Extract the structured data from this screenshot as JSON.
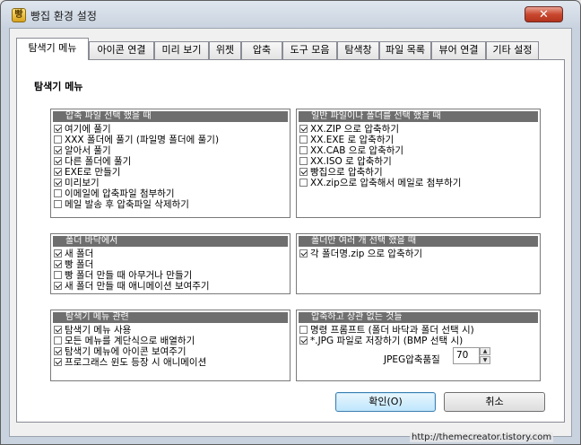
{
  "window": {
    "title": "빵집 환경 설정",
    "app_icon": "bread-app-icon",
    "close_label": "✕"
  },
  "tabs": [
    {
      "label": "탐색기 메뉴",
      "active": true
    },
    {
      "label": "아이콘 연결",
      "active": false
    },
    {
      "label": "미리 보기",
      "active": false
    },
    {
      "label": "위젯",
      "active": false
    },
    {
      "label": "압축",
      "active": false
    },
    {
      "label": "도구 모음",
      "active": false
    },
    {
      "label": "탐색창",
      "active": false
    },
    {
      "label": "파일 목록",
      "active": false
    },
    {
      "label": "뷰어 연결",
      "active": false
    },
    {
      "label": "기타 설정",
      "active": false
    }
  ],
  "panel": {
    "title": "탐색기 메뉴",
    "groups": [
      {
        "header": "압축 파일 선택 했을 때",
        "options": [
          {
            "label": "여기에 풀기",
            "checked": true
          },
          {
            "label": "XXX 폴더에 풀기 (파일명 폴더에 풀기)",
            "checked": true
          },
          {
            "label": "알아서 풀기",
            "checked": true
          },
          {
            "label": "다른 폴더에 풀기",
            "checked": true
          },
          {
            "label": "EXE로 만들기",
            "checked": true
          },
          {
            "label": "미리보기",
            "checked": true
          },
          {
            "label": "이메일에 압축파일 첨부하기",
            "checked": false
          },
          {
            "label": "메일 발송 후 압축파일 삭제하기",
            "checked": false
          }
        ]
      },
      {
        "header": "일반 파일이나 폴더를 선택 했을 때",
        "options": [
          {
            "label": "XX.ZIP 으로 압축하기",
            "checked": true
          },
          {
            "label": "XX.EXE 로 압축하기",
            "checked": false
          },
          {
            "label": "XX.CAB 으로 압축하기",
            "checked": false
          },
          {
            "label": "XX.ISO 로 압축하기",
            "checked": false
          },
          {
            "label": "빵집으로 압축하기",
            "checked": true
          },
          {
            "label": "XX.zip으로 압축해서 메일로 첨부하기",
            "checked": false
          }
        ]
      },
      {
        "header": "폴더 바닥에서",
        "options": [
          {
            "label": "새 폴더",
            "checked": true
          },
          {
            "label": "빵 폴더",
            "checked": true
          },
          {
            "label": "빵 폴더 만들 때 아무거나 만들기",
            "checked": false
          },
          {
            "label": "새 폴더 만들 때 애니메이션 보여주기",
            "checked": true
          }
        ]
      },
      {
        "header": "폴더만 여러 개 선택 했을 때",
        "options": [
          {
            "label": "각 폴더명.zip 으로 압축하기",
            "checked": true
          }
        ]
      },
      {
        "header": "탐색기 메뉴 관련",
        "options": [
          {
            "label": "탐색기 메뉴 사용",
            "checked": true
          },
          {
            "label": "모든 메뉴를 계단식으로 배열하기",
            "checked": false
          },
          {
            "label": "탐색기 메뉴에 아이콘 보여주기",
            "checked": true
          },
          {
            "label": "프로그래스 윈도 등장 시 애니메이션",
            "checked": true
          }
        ]
      },
      {
        "header": "압축하고 상관 없는 것들",
        "options": [
          {
            "label": "명령 프롬프트 (폴더 바닥과 폴더 선택 시)",
            "checked": false
          },
          {
            "label": "*.JPG 파일로 저장하기 (BMP 선택 시)",
            "checked": true
          }
        ],
        "jpeg_quality_label": "JPEG압축품질",
        "jpeg_quality_value": "70"
      }
    ]
  },
  "buttons": {
    "ok": "확인(O)",
    "cancel": "취소"
  },
  "watermark": "http://themecreator.tistory.com"
}
